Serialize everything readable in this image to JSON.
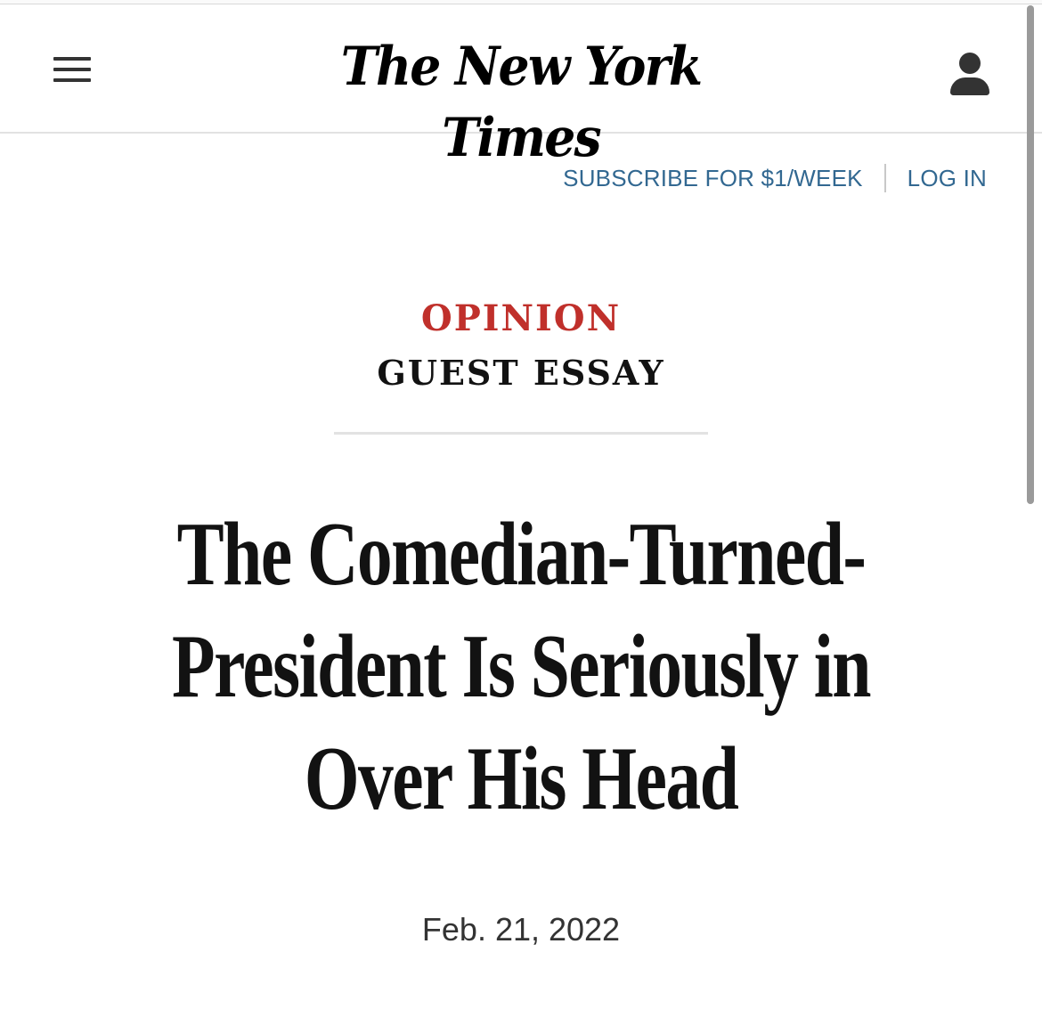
{
  "header": {
    "logo_text": "The New York Times",
    "menu_icon": "hamburger-menu-icon",
    "account_icon": "user-account-icon"
  },
  "subnav": {
    "subscribe_label": "SUBSCRIBE FOR $1/WEEK",
    "login_label": "LOG IN"
  },
  "article": {
    "section": "OPINION",
    "label": "GUEST ESSAY",
    "headline": "The Comedian-Turned-President Is Seriously in Over His Head",
    "date": "Feb. 21, 2022"
  },
  "colors": {
    "section_red": "#c0302b",
    "link_blue": "#326891",
    "text": "#121212"
  }
}
